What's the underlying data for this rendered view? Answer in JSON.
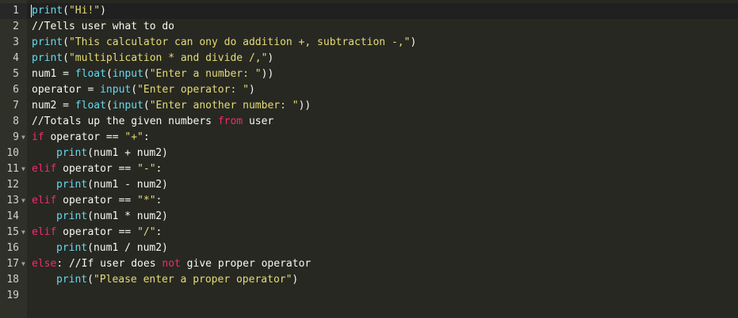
{
  "editor": {
    "theme_colors": {
      "background": "#272822",
      "gutter": "#2f3129",
      "plain": "#f8f8f2",
      "function": "#66d9ef",
      "string": "#e6db74",
      "keyword": "#f92672"
    },
    "active_line": 1,
    "lines": [
      {
        "n": "1",
        "fold": false,
        "indent": 0,
        "tokens": [
          {
            "t": "print",
            "c": "func"
          },
          {
            "t": "(",
            "c": "plain"
          },
          {
            "t": "\"Hi!\"",
            "c": "str"
          },
          {
            "t": ")",
            "c": "plain"
          }
        ]
      },
      {
        "n": "2",
        "fold": false,
        "indent": 0,
        "tokens": [
          {
            "t": "//Tells user what to do",
            "c": "comment"
          }
        ]
      },
      {
        "n": "3",
        "fold": false,
        "indent": 0,
        "tokens": [
          {
            "t": "print",
            "c": "func"
          },
          {
            "t": "(",
            "c": "plain"
          },
          {
            "t": "\"This calculator can ony do addition +, subtraction -,\"",
            "c": "str"
          },
          {
            "t": ")",
            "c": "plain"
          }
        ]
      },
      {
        "n": "4",
        "fold": false,
        "indent": 0,
        "tokens": [
          {
            "t": "print",
            "c": "func"
          },
          {
            "t": "(",
            "c": "plain"
          },
          {
            "t": "\"multiplication * and divide /,\"",
            "c": "str"
          },
          {
            "t": ")",
            "c": "plain"
          }
        ]
      },
      {
        "n": "5",
        "fold": false,
        "indent": 0,
        "tokens": [
          {
            "t": "num1 = ",
            "c": "plain"
          },
          {
            "t": "float",
            "c": "func"
          },
          {
            "t": "(",
            "c": "plain"
          },
          {
            "t": "input",
            "c": "func"
          },
          {
            "t": "(",
            "c": "plain"
          },
          {
            "t": "\"Enter a number: \"",
            "c": "str"
          },
          {
            "t": "))",
            "c": "plain"
          }
        ]
      },
      {
        "n": "6",
        "fold": false,
        "indent": 0,
        "tokens": [
          {
            "t": "operator = ",
            "c": "plain"
          },
          {
            "t": "input",
            "c": "func"
          },
          {
            "t": "(",
            "c": "plain"
          },
          {
            "t": "\"Enter operator: \"",
            "c": "str"
          },
          {
            "t": ")",
            "c": "plain"
          }
        ]
      },
      {
        "n": "7",
        "fold": false,
        "indent": 0,
        "tokens": [
          {
            "t": "num2 = ",
            "c": "plain"
          },
          {
            "t": "float",
            "c": "func"
          },
          {
            "t": "(",
            "c": "plain"
          },
          {
            "t": "input",
            "c": "func"
          },
          {
            "t": "(",
            "c": "plain"
          },
          {
            "t": "\"Enter another number: \"",
            "c": "str"
          },
          {
            "t": "))",
            "c": "plain"
          }
        ]
      },
      {
        "n": "8",
        "fold": false,
        "indent": 0,
        "tokens": [
          {
            "t": "//Totals up the given numbers ",
            "c": "comment"
          },
          {
            "t": "from",
            "c": "kw"
          },
          {
            "t": " user",
            "c": "comment"
          }
        ]
      },
      {
        "n": "9",
        "fold": true,
        "indent": 0,
        "tokens": [
          {
            "t": "if",
            "c": "kw"
          },
          {
            "t": " operator == ",
            "c": "plain"
          },
          {
            "t": "\"+\"",
            "c": "str"
          },
          {
            "t": ":",
            "c": "plain"
          }
        ]
      },
      {
        "n": "10",
        "fold": false,
        "indent": 1,
        "tokens": [
          {
            "t": "print",
            "c": "func"
          },
          {
            "t": "(num1 + num2)",
            "c": "plain"
          }
        ]
      },
      {
        "n": "11",
        "fold": true,
        "indent": 0,
        "tokens": [
          {
            "t": "elif",
            "c": "kw"
          },
          {
            "t": " operator == ",
            "c": "plain"
          },
          {
            "t": "\"-\"",
            "c": "str"
          },
          {
            "t": ":",
            "c": "plain"
          }
        ]
      },
      {
        "n": "12",
        "fold": false,
        "indent": 1,
        "tokens": [
          {
            "t": "print",
            "c": "func"
          },
          {
            "t": "(num1 - num2)",
            "c": "plain"
          }
        ]
      },
      {
        "n": "13",
        "fold": true,
        "indent": 0,
        "tokens": [
          {
            "t": "elif",
            "c": "kw"
          },
          {
            "t": " operator == ",
            "c": "plain"
          },
          {
            "t": "\"*\"",
            "c": "str"
          },
          {
            "t": ":",
            "c": "plain"
          }
        ]
      },
      {
        "n": "14",
        "fold": false,
        "indent": 1,
        "tokens": [
          {
            "t": "print",
            "c": "func"
          },
          {
            "t": "(num1 * num2)",
            "c": "plain"
          }
        ]
      },
      {
        "n": "15",
        "fold": true,
        "indent": 0,
        "tokens": [
          {
            "t": "elif",
            "c": "kw"
          },
          {
            "t": " operator == ",
            "c": "plain"
          },
          {
            "t": "\"/\"",
            "c": "str"
          },
          {
            "t": ":",
            "c": "plain"
          }
        ]
      },
      {
        "n": "16",
        "fold": false,
        "indent": 1,
        "tokens": [
          {
            "t": "print",
            "c": "func"
          },
          {
            "t": "(num1 / num2)",
            "c": "plain"
          }
        ]
      },
      {
        "n": "17",
        "fold": true,
        "indent": 0,
        "tokens": [
          {
            "t": "else",
            "c": "kw"
          },
          {
            "t": ": //If user does ",
            "c": "comment"
          },
          {
            "t": "not",
            "c": "kw"
          },
          {
            "t": " give proper operator",
            "c": "comment"
          }
        ]
      },
      {
        "n": "18",
        "fold": false,
        "indent": 1,
        "tokens": [
          {
            "t": "print",
            "c": "func"
          },
          {
            "t": "(",
            "c": "plain"
          },
          {
            "t": "\"Please enter a proper operator\"",
            "c": "str"
          },
          {
            "t": ")",
            "c": "plain"
          }
        ]
      },
      {
        "n": "19",
        "fold": false,
        "indent": 0,
        "tokens": []
      }
    ]
  }
}
